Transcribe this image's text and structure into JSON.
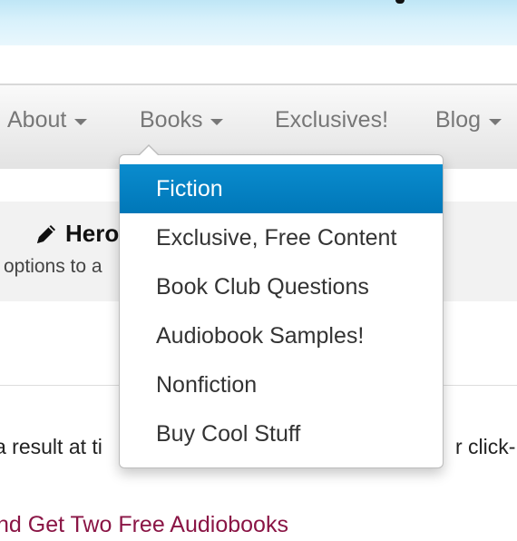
{
  "nav": {
    "items": [
      {
        "label": "About",
        "has_caret": true
      },
      {
        "label": "Books",
        "has_caret": true
      },
      {
        "label": "Exclusives!",
        "has_caret": false
      },
      {
        "label": "Blog",
        "has_caret": true
      }
    ]
  },
  "dropdown": {
    "items": [
      {
        "label": "Fiction",
        "active": true
      },
      {
        "label": "Exclusive, Free Content",
        "active": false
      },
      {
        "label": "Book Club Questions",
        "active": false
      },
      {
        "label": "Audiobook Samples!",
        "active": false
      },
      {
        "label": "Nonfiction",
        "active": false
      },
      {
        "label": "Buy Cool Stuff",
        "active": false
      }
    ],
    "active_color": "#0a84c6"
  },
  "hero": {
    "icon": "pencil-icon",
    "title_fragment": "Hero",
    "subtitle_fragment": "options to a"
  },
  "content": {
    "text_left": "a result at ti",
    "text_right": "r click-",
    "promo_link": "nd Get Two Free Audiobooks",
    "promo_color": "#8a1545"
  }
}
